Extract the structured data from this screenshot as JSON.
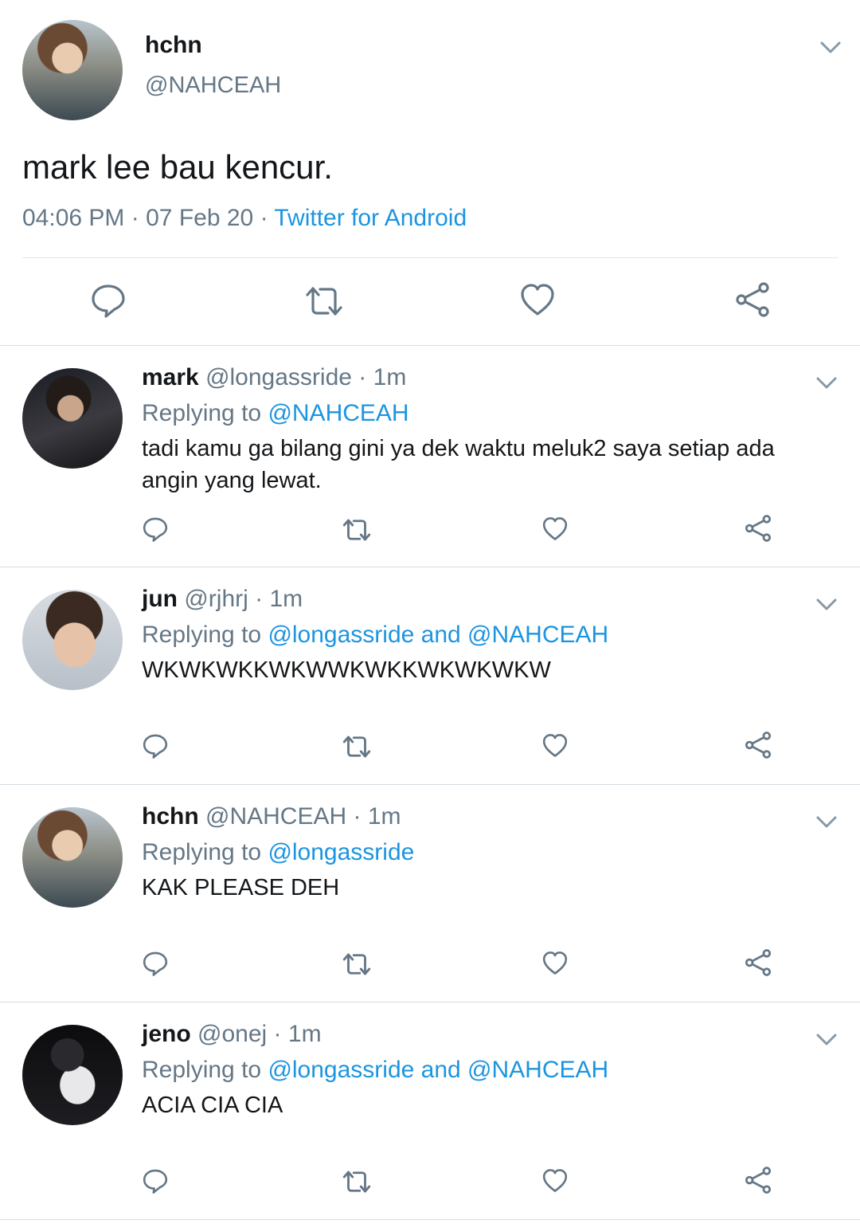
{
  "main_tweet": {
    "name": "hchn",
    "handle": "@NAHCEAH",
    "text": "mark lee bau kencur.",
    "time": "04:06 PM",
    "sep1": "·",
    "date": "07 Feb 20",
    "sep2": "·",
    "source": "Twitter for Android",
    "avatar": "avatar-hchn"
  },
  "replies": [
    {
      "name": "mark",
      "handle": "@longassride",
      "dot": "·",
      "time": "1m",
      "replying_prefix": "Replying to",
      "mentions": "@NAHCEAH",
      "text": "tadi kamu ga bilang gini ya dek waktu meluk2 saya setiap ada angin yang lewat."
    },
    {
      "name": "jun",
      "handle": "@rjhrj",
      "dot": "·",
      "time": "1m",
      "replying_prefix": "Replying to",
      "mentions": "@longassride and @NAHCEAH",
      "text": "WKWKWKKWKWWKWKKWKWKWKW"
    },
    {
      "name": "hchn",
      "handle": "@NAHCEAH",
      "dot": "·",
      "time": "1m",
      "replying_prefix": "Replying to",
      "mentions": "@longassride",
      "text": "KAK PLEASE DEH"
    },
    {
      "name": "jeno",
      "handle": "@onej",
      "dot": "·",
      "time": "1m",
      "replying_prefix": "Replying to",
      "mentions": "@longassride and @NAHCEAH",
      "text": "ACIA CIA CIA"
    }
  ],
  "icons": {
    "reply": "speech-bubble-icon",
    "retweet": "retweet-icon",
    "like": "heart-icon",
    "share": "share-icon",
    "menu": "chevron-down-icon"
  },
  "colors": {
    "text": "#14171a",
    "secondary": "#657786",
    "link": "#1b95e0",
    "divider": "#e1e8ed"
  }
}
